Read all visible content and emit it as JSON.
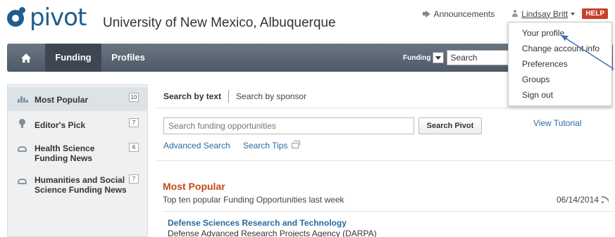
{
  "header": {
    "logo_text": "pivot",
    "institution": "University of New Mexico, Albuquerque",
    "announcements": "Announcements",
    "user_name": "Lindsay Britt",
    "help": "HELP"
  },
  "user_menu": {
    "items": [
      "Your profile",
      "Change account info",
      "Preferences",
      "Groups",
      "Sign out"
    ]
  },
  "nav": {
    "tabs": [
      "Funding",
      "Profiles"
    ],
    "search_scope": "Funding",
    "search_placeholder": "Search"
  },
  "sidebar": {
    "items": [
      {
        "label": "Most Popular",
        "count": "10"
      },
      {
        "label": "Editor's Pick",
        "count": "7"
      },
      {
        "label": "Health Science Funding News",
        "count": "6"
      },
      {
        "label": "Humanities and Social Science Funding News",
        "count": "7"
      }
    ]
  },
  "search": {
    "tabs": [
      "Search by text",
      "Search by sponsor"
    ],
    "placeholder": "Search funding opportunities",
    "button": "Search Pivot",
    "advanced": "Advanced Search",
    "tips": "Search Tips",
    "tutorial": "View Tutorial"
  },
  "popular": {
    "title": "Most Popular",
    "subtitle": "Top ten popular Funding Opportunities last week",
    "date": "06/14/2014",
    "items": [
      {
        "title": "Defense Sciences Research and Technology",
        "sponsor": "Defense Advanced Research Projects Agency (DARPA)"
      }
    ]
  },
  "colors": {
    "brand": "#1f5e8c",
    "nav_bar": "#56616d",
    "link": "#2a6aa0",
    "section_title": "#c44a1c",
    "help_badge": "#c6412c",
    "annotation_arrow": "#3f74b5"
  }
}
